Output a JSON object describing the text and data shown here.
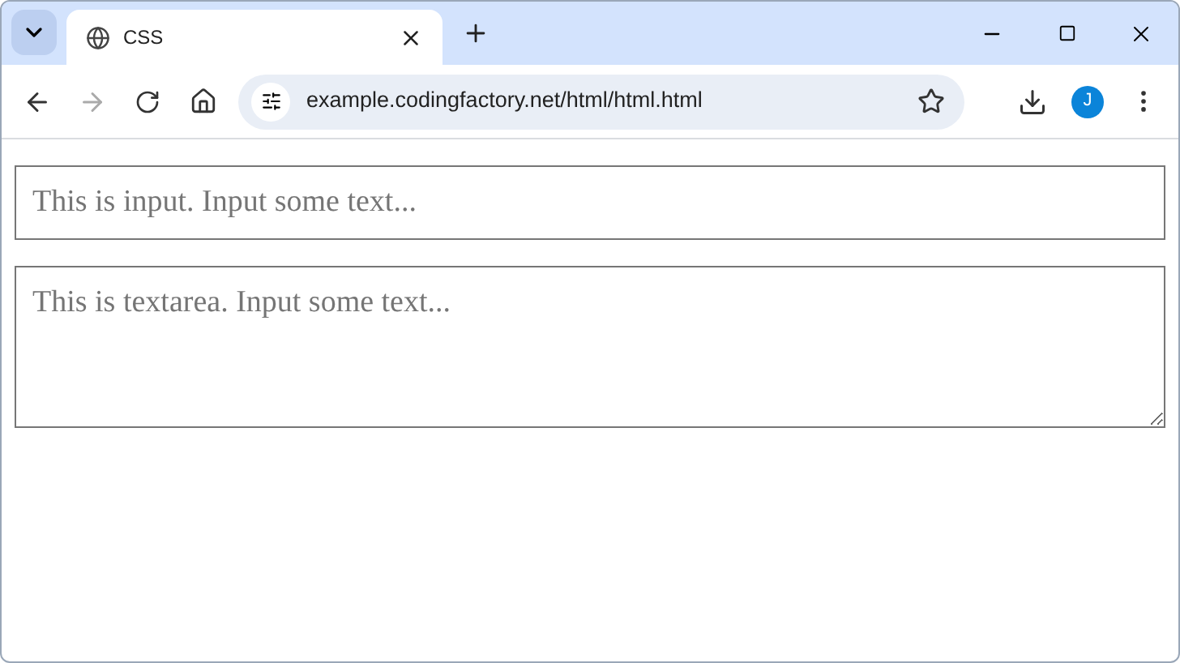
{
  "browser": {
    "tabs": [
      {
        "title": "CSS",
        "selected": true
      }
    ],
    "forward_disabled": true,
    "address": "example.codingfactory.net/html/html.html",
    "profile_initial": "J"
  },
  "page": {
    "input": {
      "placeholder": "This is input. Input some text..."
    },
    "textarea": {
      "placeholder": "This is textarea. Input some text..."
    }
  }
}
